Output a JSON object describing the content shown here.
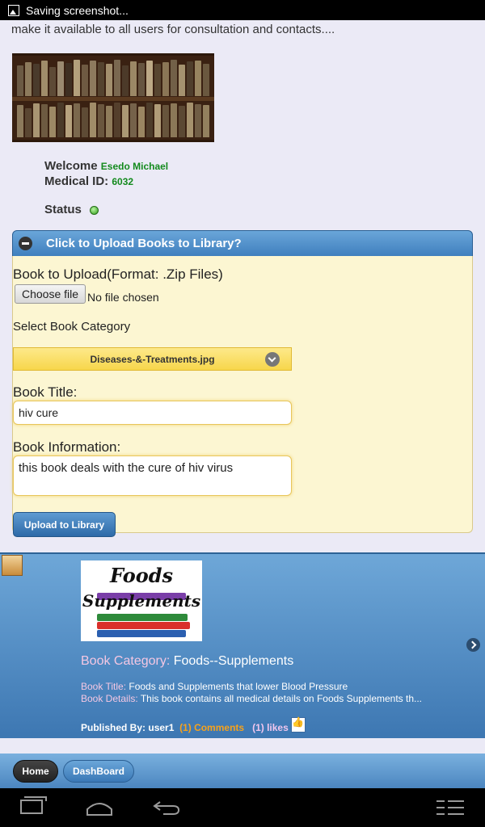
{
  "status_bar": {
    "notification": "Saving screenshot..."
  },
  "intro_text": "make it available to all users for consultation and contacts....",
  "user": {
    "welcome_label": "Welcome",
    "name": "Esedo Michael",
    "medical_id_label": "Medical ID:",
    "medical_id": "6032",
    "status_label": "Status"
  },
  "upload": {
    "header": "Click to Upload Books to Library?",
    "file_label": "Book to Upload(Format: .Zip Files)",
    "choose_file": "Choose file",
    "no_file": "No file chosen",
    "category_label": "Select Book Category",
    "category_value": "Diseases-&-Treatments.jpg",
    "title_label": "Book Title:",
    "title_value": "hiv cure",
    "info_label": "Book Information:",
    "info_value": "this book deals with the cure of hiv virus",
    "submit": "Upload to Library"
  },
  "feed": {
    "logo_line1": "Foods",
    "logo_line2": "Supplements",
    "category_label": "Book Category:",
    "category_value": "Foods--Supplements",
    "title_label": "Book Title:",
    "title_value": "Foods and Supplements that lower Blood Pressure",
    "details_label": "Book Details:",
    "details_value": "This book contains all medical details on Foods Supplements th...",
    "published_label": "Published By:",
    "published_by": "user1",
    "comments": "(1) Comments",
    "likes": "(1) likes"
  },
  "footer": {
    "home": "Home",
    "dashboard": "DashBoard"
  },
  "colors": {
    "accent_blue": "#3f7fbe",
    "panel_yellow": "#fcf6d2",
    "green_text": "#138a1d"
  }
}
